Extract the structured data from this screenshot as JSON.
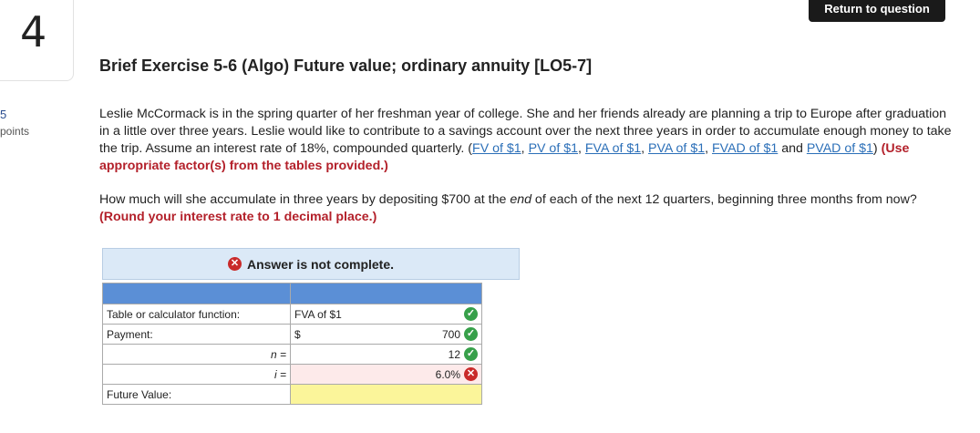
{
  "question": {
    "number": "4",
    "points_value": "5",
    "points_label": "points"
  },
  "header": {
    "return_label": "Return to question"
  },
  "title": "Brief Exercise 5-6 (Algo) Future value; ordinary annuity [LO5-7]",
  "body": {
    "p1_text": "Leslie McCormack is in the spring quarter of her freshman year of college. She and her friends already are planning a trip to Europe after graduation in a little over three years. Leslie would like to contribute to a savings account over the next three years in order to accumulate enough money to take the trip. Assume an interest rate of 18%, compounded quarterly. (",
    "links": [
      "FV of $1",
      "PV of $1",
      "FVA of $1",
      "PVA of $1",
      "FVAD of $1",
      "PVAD of $1"
    ],
    "sep_comma": ", ",
    "sep_and": " and ",
    "close_paren": ") ",
    "p1_instruction": "(Use appropriate factor(s) from the tables provided.)",
    "p2_text_a": "How much will she accumulate in three years by depositing $700 at the ",
    "p2_emph": "end",
    "p2_text_b": " of each of the next 12 quarters, beginning three months from now? ",
    "p2_instruction": "(Round your interest rate to 1 decimal place.)"
  },
  "banner": {
    "text": "Answer is not complete."
  },
  "table": {
    "rows": [
      {
        "label": "Table or calculator function:",
        "value": "FVA of $1",
        "status": "correct"
      },
      {
        "label": "Payment:",
        "currency": "$",
        "value": "700",
        "status": "correct"
      },
      {
        "label": "n =",
        "value": "12",
        "status": "correct"
      },
      {
        "label": "i =",
        "value": "6.0%",
        "status": "incorrect"
      },
      {
        "label": "Future Value:",
        "value": "",
        "status": "empty"
      }
    ]
  },
  "icons": {
    "correct_color": "#37a04a",
    "incorrect_color": "#c92a2a",
    "accent": "#5b8fd6"
  }
}
